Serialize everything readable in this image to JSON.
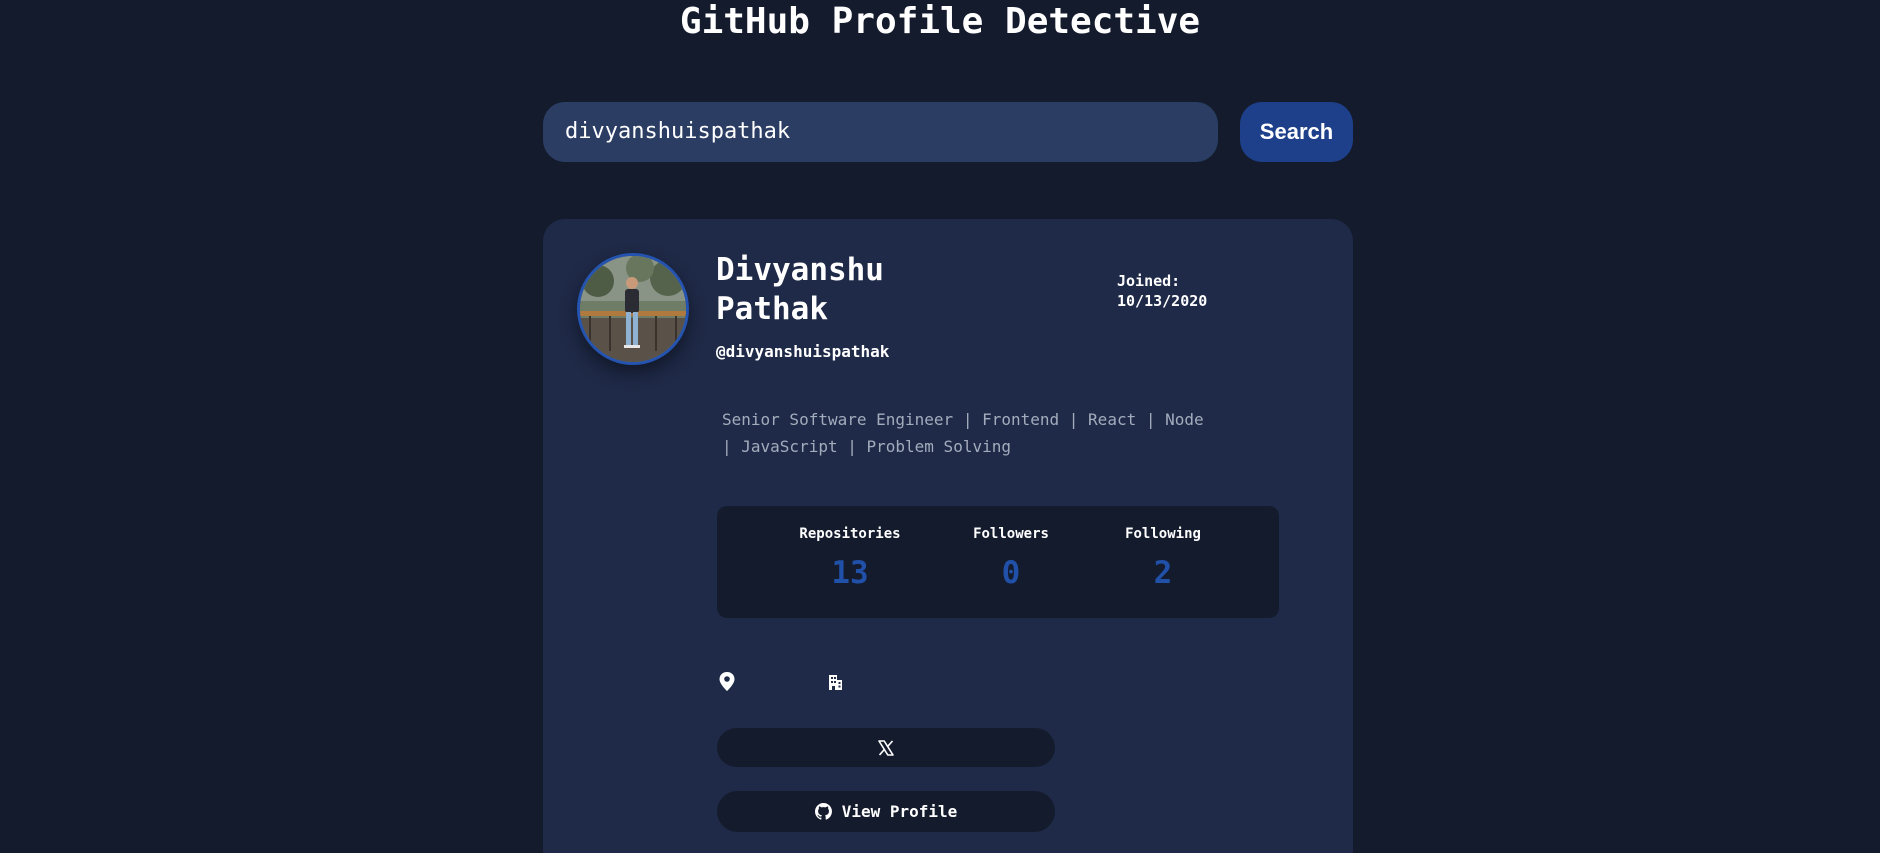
{
  "app": {
    "title": "GitHub Profile Detective"
  },
  "search": {
    "value": "divyanshuispathak",
    "button_label": "Search"
  },
  "profile": {
    "name": "Divyanshu Pathak",
    "username": "@divyanshuispathak",
    "joined_label": "Joined:",
    "joined_date": "10/13/2020",
    "bio": "Senior Software Engineer | Frontend | React | Node | JavaScript | Problem Solving",
    "avatar_icon": "profile-photo",
    "stats": [
      {
        "label": "Repositories",
        "value": "13"
      },
      {
        "label": "Followers",
        "value": "0"
      },
      {
        "label": "Following",
        "value": "2"
      }
    ],
    "meta_icons": [
      "location-pin-icon",
      "building-icon"
    ],
    "twitter_icon": "x-logo-icon",
    "view_profile_label": "View Profile",
    "view_profile_icon": "github-icon"
  },
  "colors": {
    "background": "#141b2d",
    "card": "#1f2a48",
    "input": "#2c3d63",
    "accent": "#1e3f8a",
    "stat_value": "#2050a8",
    "bio_text": "#a3acbc"
  }
}
